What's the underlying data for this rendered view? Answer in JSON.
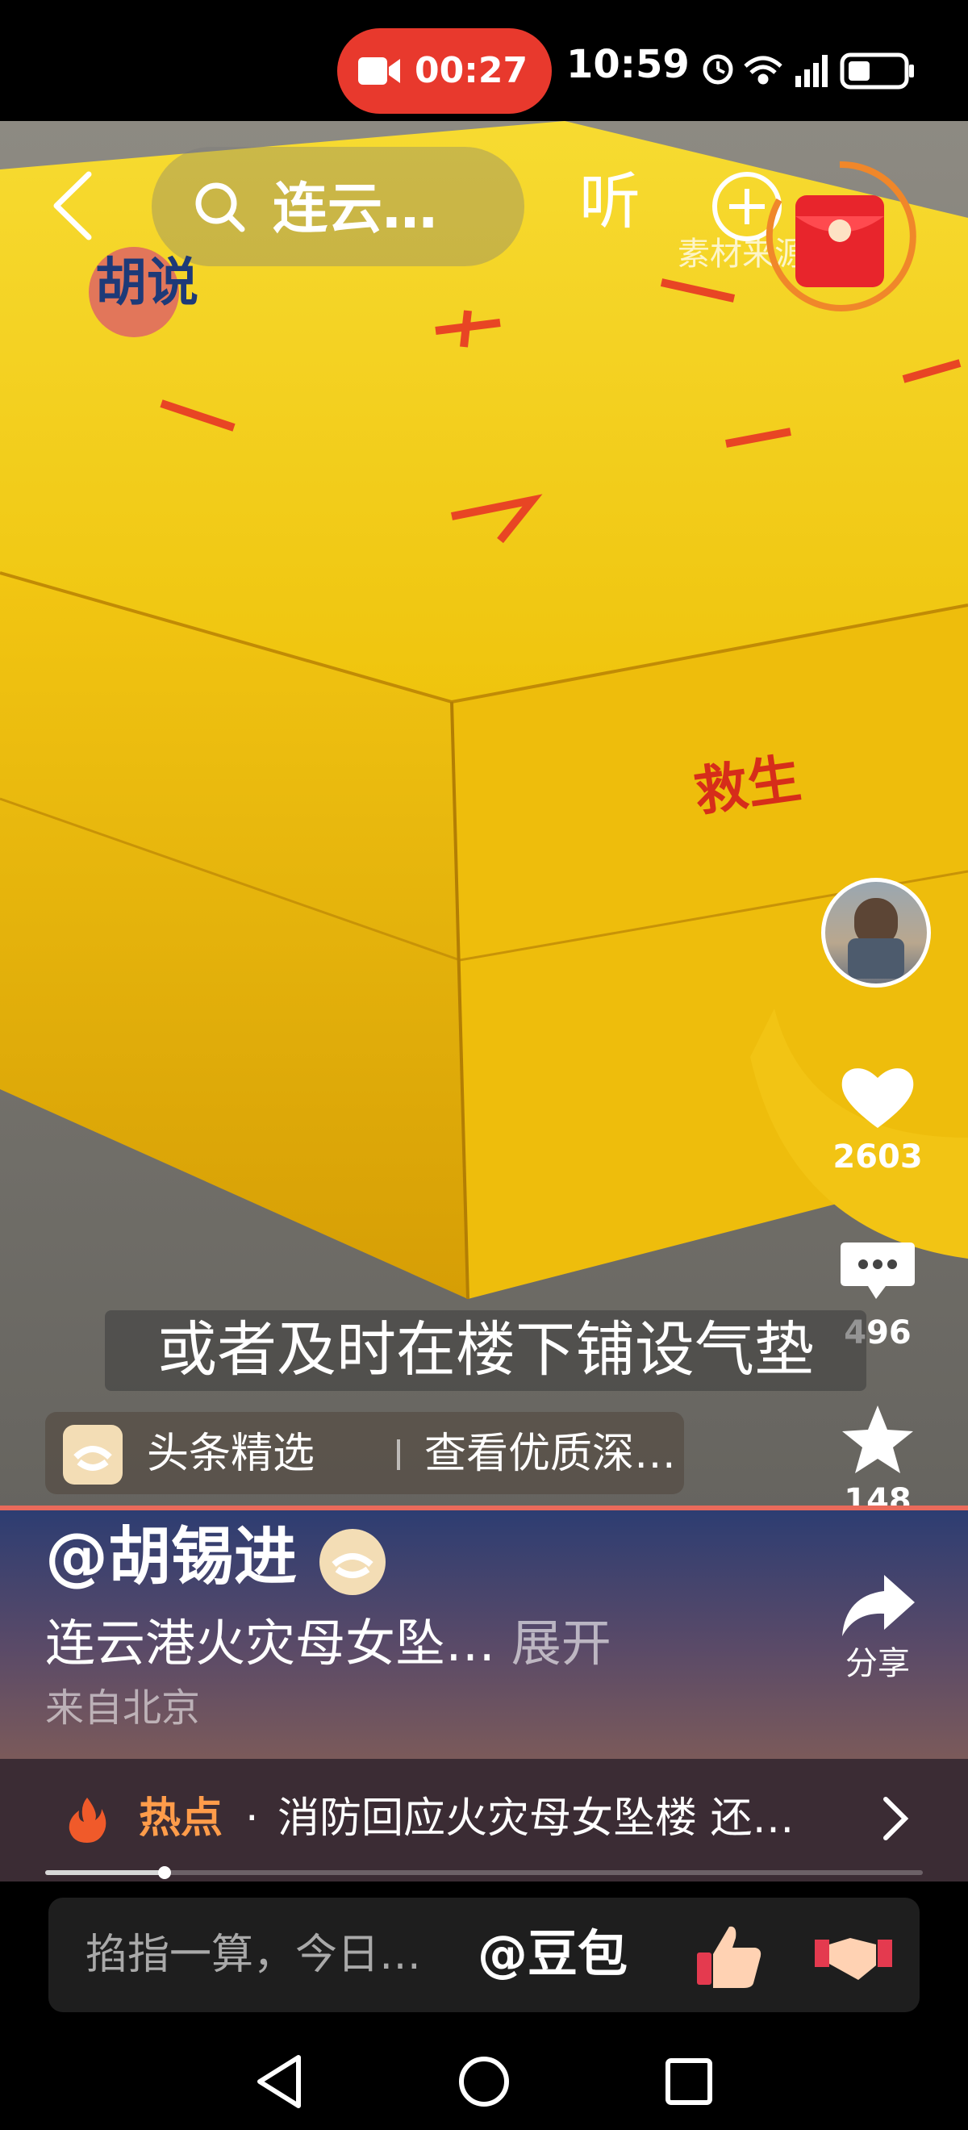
{
  "status_bar": {
    "recording_time": "00:27",
    "clock": "10:59",
    "icons": [
      "alarm-icon",
      "wifi-icon",
      "5g-signal-icon",
      "battery-icon"
    ]
  },
  "top_nav": {
    "search_text": "连云…",
    "listen_label": "听",
    "source_label": "素材来源",
    "logo_text": "胡说"
  },
  "video": {
    "mat_text_front": "救生",
    "caption": "或者及时在楼下铺设气垫",
    "source_tag": {
      "label": "头条精选",
      "description": "查看优质深…"
    }
  },
  "rail": {
    "likes": "2603",
    "comments": "496",
    "favorites": "148",
    "share_label": "分享"
  },
  "info": {
    "author": "@胡锡进",
    "description": "连云港火灾母女坠…",
    "expand_label": "展开",
    "location": "来自北京"
  },
  "hot": {
    "label": "热点",
    "dot": "·",
    "text": "消防回应火灾母女坠楼 还…"
  },
  "progress": {
    "fraction": 0.136
  },
  "comment_bar": {
    "placeholder": "掐指一算，今日…",
    "mention": "@豆包"
  },
  "colors": {
    "record_red": "#e8392d",
    "hot_orange": "#ff9c4a",
    "mat_yellow": "#f3c70f",
    "divider": "#e96a5b"
  }
}
